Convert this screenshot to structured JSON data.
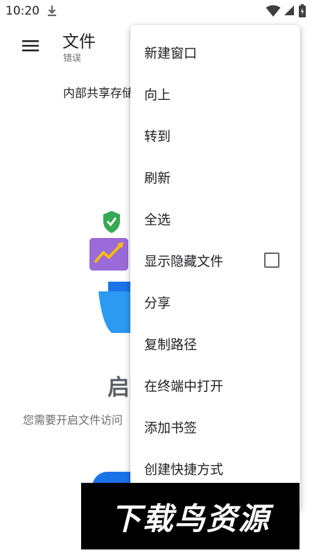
{
  "status_bar": {
    "time": "10:20",
    "icons": [
      "download-icon",
      "wifi-icon",
      "signal-icon",
      "battery-icon"
    ]
  },
  "app_bar": {
    "title": "文件",
    "subtitle": "错误",
    "menu_icon": "hamburger-menu-icon"
  },
  "breadcrumb": {
    "text": "内部共享存储"
  },
  "empty_state": {
    "heading": "启",
    "description": "您需要开启文件访问"
  },
  "overflow_menu": {
    "items": [
      {
        "label": "新建窗口"
      },
      {
        "label": "向上"
      },
      {
        "label": "转到"
      },
      {
        "label": "刷新"
      },
      {
        "label": "全选"
      },
      {
        "label": "显示隐藏文件",
        "checkbox": true,
        "checked": false
      },
      {
        "label": "分享"
      },
      {
        "label": "复制路径"
      },
      {
        "label": "在终端中打开"
      },
      {
        "label": "添加书签"
      },
      {
        "label": "创建快捷方式"
      }
    ]
  },
  "watermark": {
    "text": "下载鸟资源"
  },
  "colors": {
    "accent_blue": "#1a73e8",
    "shield_green": "#34a853",
    "chart_purple": "#9b6bd9",
    "chart_yellow": "#fbbc04",
    "folder_blue": "#2b9af3"
  }
}
